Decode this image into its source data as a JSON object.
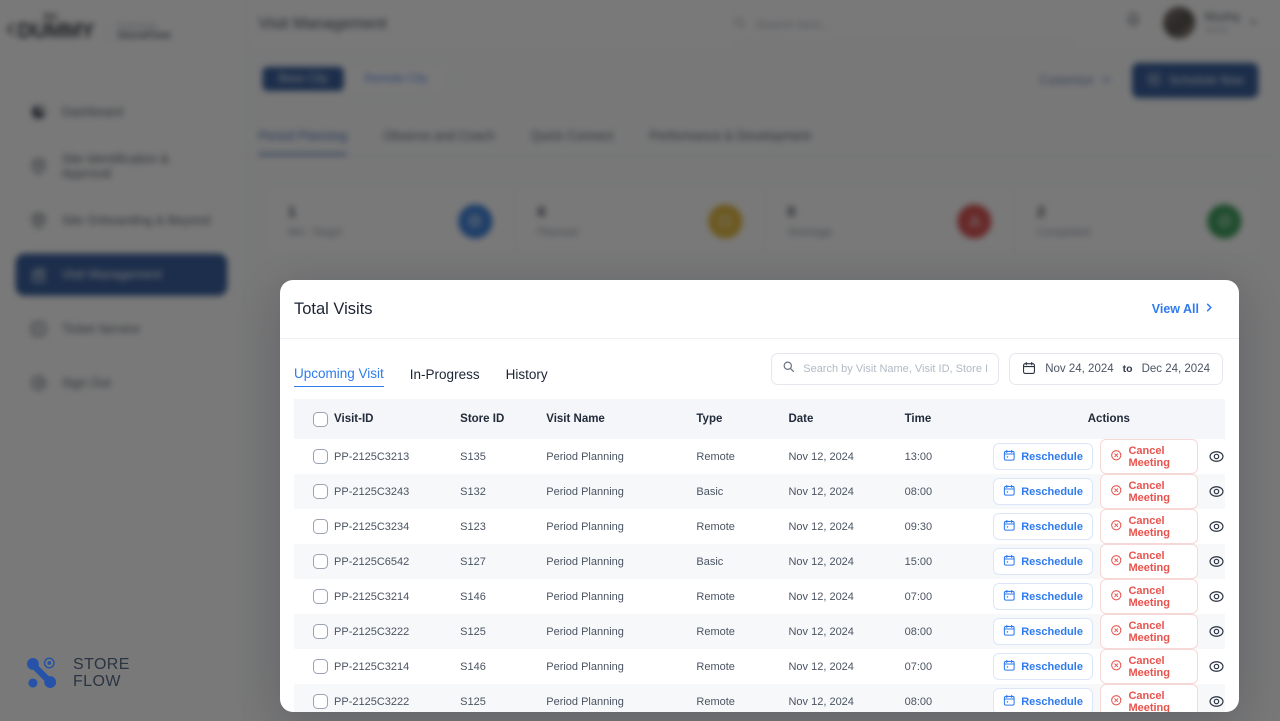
{
  "brand": {
    "mark": "DUMMY",
    "superscript": "BIG",
    "powered_by": "Powered by",
    "product": "StoreFlow",
    "footer_logo_line1": "STORE",
    "footer_logo_line2": "FLOW"
  },
  "header": {
    "page_title": "Visit Management",
    "search_placeholder": "Search here...",
    "bell_icon": "bell-icon",
    "user_name": "Mushq",
    "user_role": "Admin",
    "chevron_icon": "chevron-down-icon"
  },
  "sidebar": {
    "items": [
      {
        "label": "Dashboard",
        "icon": "dashboard-pie-icon",
        "active": false
      },
      {
        "label": "Site Identification & Approval",
        "icon": "site-identification-icon",
        "active": false
      },
      {
        "label": "Site Onboarding & Beyond",
        "icon": "site-onboarding-shield-icon",
        "active": false
      },
      {
        "label": "Visit Management",
        "icon": "visit-management-icon",
        "active": true
      },
      {
        "label": "Ticket Service",
        "icon": "ticket-service-icon",
        "active": false
      },
      {
        "label": "Sign Out",
        "icon": "sign-out-icon",
        "active": false
      }
    ]
  },
  "segmented": {
    "options": [
      {
        "label": "Base City",
        "active": true
      },
      {
        "label": "Remote City",
        "active": false
      }
    ]
  },
  "actions": {
    "customize_label": "Customize",
    "customize_icon": "chevron-down-icon",
    "schedule_label": "Schedule Now",
    "schedule_icon": "calendar-plus-icon"
  },
  "tabs": [
    {
      "label": "Period Planning",
      "active": true
    },
    {
      "label": "Observe and Coach",
      "active": false
    },
    {
      "label": "Quick Connect",
      "active": false
    },
    {
      "label": "Performance & Development",
      "active": false
    }
  ],
  "stats": [
    {
      "value": "1",
      "label": "Min. Target",
      "color": "#1264d4",
      "icon": "target-icon"
    },
    {
      "value": "6",
      "label": "Planned",
      "color": "#ddaa14",
      "icon": "planned-icon"
    },
    {
      "value": "0",
      "label": "Shortage",
      "color": "#d22d2d",
      "icon": "warning-icon"
    },
    {
      "value": "2",
      "label": "Completed",
      "color": "#118837",
      "icon": "check-icon"
    }
  ],
  "modal": {
    "title": "Total Visits",
    "view_all_label": "View All",
    "view_all_icon": "chevron-right-icon",
    "tabs": [
      {
        "label": "Upcoming Visit",
        "active": true
      },
      {
        "label": "In-Progress",
        "active": false
      },
      {
        "label": "History",
        "active": false
      }
    ],
    "search": {
      "placeholder": "Search by Visit Name, Visit ID, Store ID",
      "value": "",
      "icon": "search-icon"
    },
    "date_range": {
      "icon": "calendar-icon",
      "start": "Nov 24, 2024",
      "separator": "to",
      "end": "Dec 24, 2024"
    },
    "table": {
      "columns": [
        "Visit-ID",
        "Store ID",
        "Visit Name",
        "Type",
        "Date",
        "Time",
        "Actions"
      ],
      "row_actions": {
        "reschedule_label": "Reschedule",
        "reschedule_icon": "calendar-icon",
        "cancel_label": "Cancel Meeting",
        "cancel_icon": "x-circle-icon",
        "view_icon": "eye-icon"
      },
      "rows": [
        {
          "visit_id": "PP-2125C3213",
          "store_id": "S135",
          "visit_name": "Period Planning",
          "type": "Remote",
          "date": "Nov 12, 2024",
          "time": "13:00"
        },
        {
          "visit_id": "PP-2125C3243",
          "store_id": "S132",
          "visit_name": "Period Planning",
          "type": "Basic",
          "date": "Nov 12, 2024",
          "time": "08:00"
        },
        {
          "visit_id": "PP-2125C3234",
          "store_id": "S123",
          "visit_name": "Period Planning",
          "type": "Remote",
          "date": "Nov 12, 2024",
          "time": "09:30"
        },
        {
          "visit_id": "PP-2125C6542",
          "store_id": "S127",
          "visit_name": "Period Planning",
          "type": "Basic",
          "date": "Nov 12, 2024",
          "time": "15:00"
        },
        {
          "visit_id": "PP-2125C3214",
          "store_id": "S146",
          "visit_name": "Period Planning",
          "type": "Remote",
          "date": "Nov 12, 2024",
          "time": "07:00"
        },
        {
          "visit_id": "PP-2125C3222",
          "store_id": "S125",
          "visit_name": "Period Planning",
          "type": "Remote",
          "date": "Nov 12, 2024",
          "time": "08:00"
        },
        {
          "visit_id": "PP-2125C3214",
          "store_id": "S146",
          "visit_name": "Period Planning",
          "type": "Remote",
          "date": "Nov 12, 2024",
          "time": "07:00"
        },
        {
          "visit_id": "PP-2125C3222",
          "store_id": "S125",
          "visit_name": "Period Planning",
          "type": "Remote",
          "date": "Nov 12, 2024",
          "time": "08:00"
        }
      ]
    }
  },
  "colors": {
    "brand_blue": "#0b3a86",
    "link_blue": "#2e7bef",
    "danger_red": "#e8534e"
  }
}
